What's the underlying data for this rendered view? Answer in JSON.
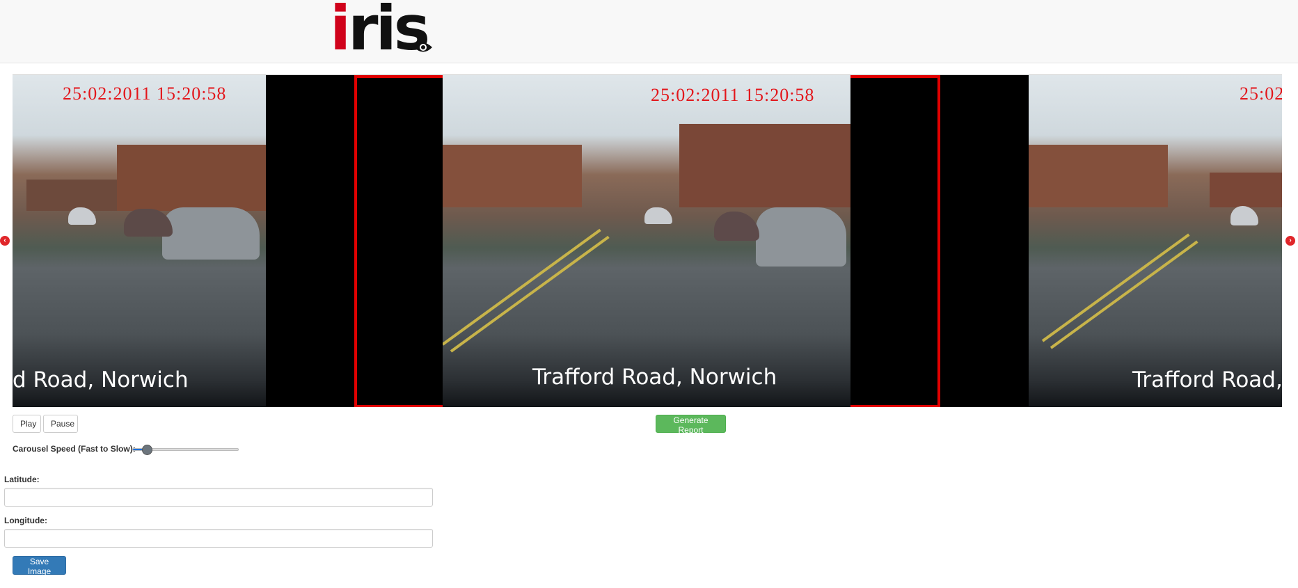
{
  "header": {
    "logo_text": "iris",
    "logo_icon": "eye-icon",
    "brand_color": "#d0021b"
  },
  "carousel": {
    "slides": [
      {
        "timestamp": "25:02:2011 15:20:58",
        "caption": "d Road, Norwich"
      },
      {
        "timestamp": "25:02:2011 15:20:58",
        "caption": "Trafford Road, Norwich"
      },
      {
        "timestamp": "25:02",
        "caption": "Trafford Road, N"
      }
    ],
    "prev_icon": "chevron-left-icon",
    "next_icon": "chevron-right-icon",
    "active_border_color": "#e00000"
  },
  "controls": {
    "play_label": "Play",
    "pause_label": "Pause",
    "generate_report_label": "Generate Report",
    "speed_label": "Carousel Speed (Fast to Slow):",
    "speed_fraction": 0.13
  },
  "form": {
    "latitude_label": "Latitude:",
    "latitude_value": "",
    "longitude_label": "Longitude:",
    "longitude_value": "",
    "save_label": "Save Image"
  }
}
